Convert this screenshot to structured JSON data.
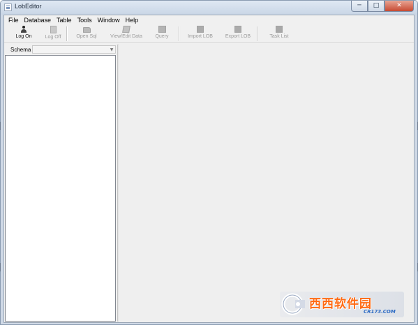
{
  "window": {
    "title": "LobEditor",
    "controls": {
      "minimize": "─",
      "maximize": "□",
      "close": "✕"
    }
  },
  "menu": [
    "File",
    "Database",
    "Table",
    "Tools",
    "Window",
    "Help"
  ],
  "toolbar": {
    "log_on": "Log On",
    "log_off": "Log Off",
    "open_sql": "Open Sql",
    "view_edit_data": "View/Edit Data",
    "query": "Query",
    "import_lob": "Import LOB",
    "export_lob": "Export LOB",
    "task_list": "Task List"
  },
  "schema": {
    "label": "Schema",
    "selected": ""
  },
  "watermark": {
    "brand": "西西软件园",
    "url": "CR173.COM"
  },
  "icons": {
    "log_on": "person-icon",
    "log_off": "document-lock-icon",
    "open_sql": "folder-icon",
    "view_edit_data": "edit-icon",
    "query": "query-icon",
    "import_lob": "import-icon",
    "export_lob": "export-icon",
    "task_list": "task-list-icon"
  },
  "colors": {
    "watermark_orange": "#ff6a13",
    "watermark_blue": "#2d6bc4",
    "disabled_text": "#9a9a9a"
  }
}
